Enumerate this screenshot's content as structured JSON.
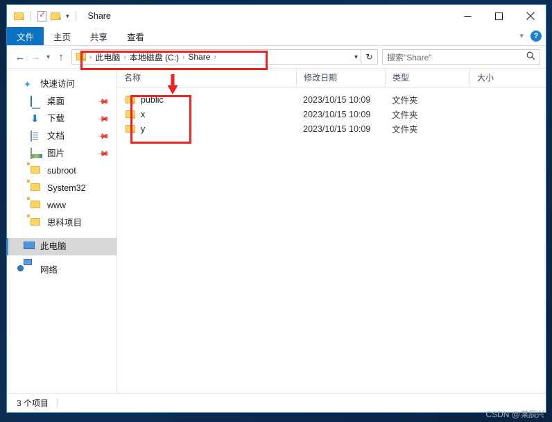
{
  "window": {
    "title": "Share",
    "quick_access": [
      {
        "name": "folder-icon",
        "tooltip": "folder"
      },
      {
        "name": "properties-icon",
        "tooltip": "properties"
      },
      {
        "name": "new-folder-icon",
        "tooltip": "new folder"
      }
    ],
    "controls": {
      "minimize": "—",
      "maximize": "□",
      "close": "✕"
    },
    "ribbon_expand": "⌄",
    "help": "?"
  },
  "ribbon": {
    "tabs": [
      {
        "label": "文件",
        "active": true
      },
      {
        "label": "主页",
        "active": false
      },
      {
        "label": "共享",
        "active": false
      },
      {
        "label": "查看",
        "active": false
      }
    ]
  },
  "navigation": {
    "back": "←",
    "forward": "→",
    "history_dropdown": "⌄",
    "up": "↑",
    "refresh": "↻",
    "path_dropdown": "⌄",
    "breadcrumbs": [
      {
        "label": "此电脑"
      },
      {
        "label": "本地磁盘 (C:)"
      },
      {
        "label": "Share"
      }
    ],
    "separator": "›"
  },
  "search": {
    "placeholder": "搜索\"Share\"",
    "icon": "⌕"
  },
  "sidebar": {
    "items": [
      {
        "label": "快速访问",
        "icon": "pin-star-icon",
        "pinned": false,
        "indent": 0,
        "selected": false
      },
      {
        "label": "桌面",
        "icon": "desktop-icon",
        "pinned": true,
        "indent": 1,
        "selected": false
      },
      {
        "label": "下载",
        "icon": "download-icon",
        "pinned": true,
        "indent": 1,
        "selected": false
      },
      {
        "label": "文档",
        "icon": "documents-icon",
        "pinned": true,
        "indent": 1,
        "selected": false
      },
      {
        "label": "图片",
        "icon": "pictures-icon",
        "pinned": true,
        "indent": 1,
        "selected": false
      },
      {
        "label": "subroot",
        "icon": "folder-icon",
        "pinned": false,
        "indent": 1,
        "selected": false
      },
      {
        "label": "System32",
        "icon": "folder-icon",
        "pinned": false,
        "indent": 1,
        "selected": false
      },
      {
        "label": "www",
        "icon": "folder-icon",
        "pinned": false,
        "indent": 1,
        "selected": false
      },
      {
        "label": "思科项目",
        "icon": "folder-icon",
        "pinned": false,
        "indent": 1,
        "selected": false
      },
      {
        "label": "此电脑",
        "icon": "this-pc-icon",
        "pinned": false,
        "indent": 0,
        "selected": true
      },
      {
        "label": "网络",
        "icon": "network-icon",
        "pinned": false,
        "indent": 0,
        "selected": false
      }
    ],
    "pin_glyph": "✒"
  },
  "file_list": {
    "columns": [
      {
        "label": "名称",
        "key": "name"
      },
      {
        "label": "修改日期",
        "key": "date"
      },
      {
        "label": "类型",
        "key": "type"
      },
      {
        "label": "大小",
        "key": "size"
      }
    ],
    "sort_indicator": "⌃",
    "rows": [
      {
        "name": "public",
        "date": "2023/10/15 10:09",
        "type": "文件夹",
        "size": "",
        "icon": "folder-icon"
      },
      {
        "name": "x",
        "date": "2023/10/15 10:09",
        "type": "文件夹",
        "size": "",
        "icon": "folder-icon"
      },
      {
        "name": "y",
        "date": "2023/10/15 10:09",
        "type": "文件夹",
        "size": "",
        "icon": "folder-icon"
      }
    ]
  },
  "status_bar": {
    "item_count": "3 个项目"
  },
  "annotations": {
    "color": "#ef2121",
    "path_highlight": "red-rectangle-around-address-path",
    "folders_highlight": "red-rectangle-around-folder-list",
    "arrow": "red-down-arrow-pointing-at-folder-list"
  },
  "watermark": {
    "prefix": "CSDN @",
    "obscured": "某辰兴"
  }
}
